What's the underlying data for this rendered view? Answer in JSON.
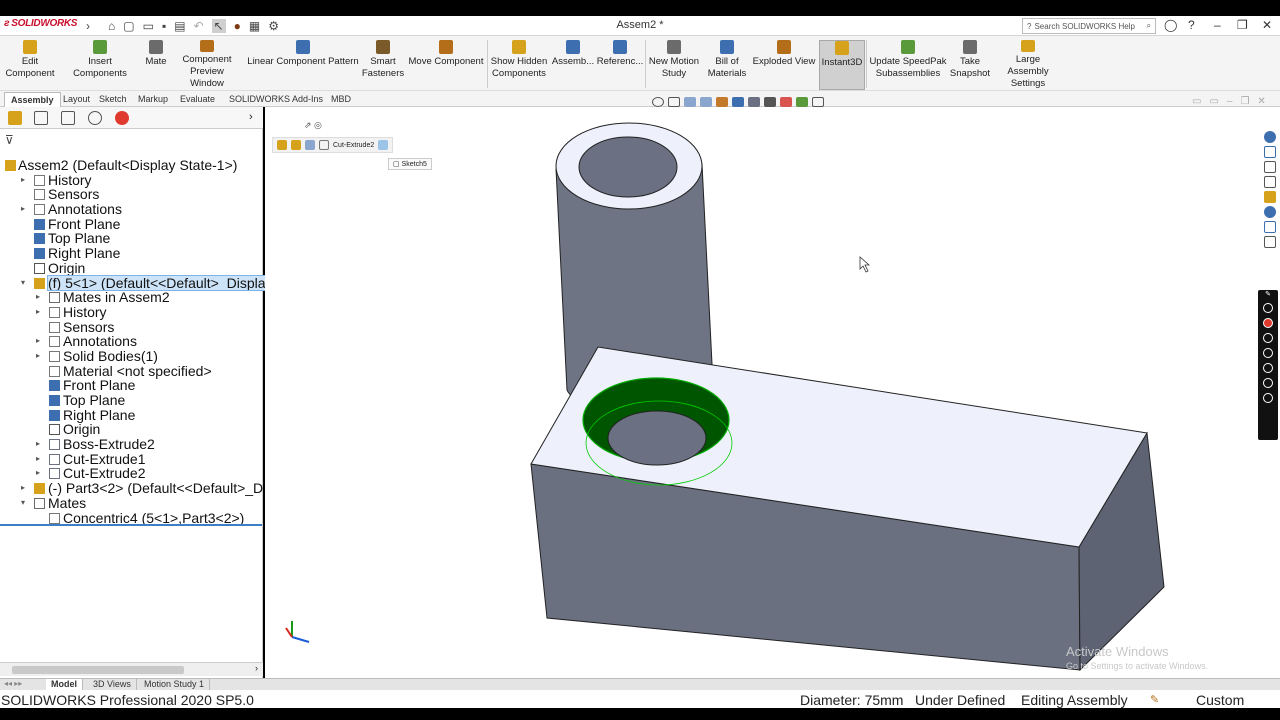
{
  "app": {
    "logo": "SOLIDWORKS",
    "window_title": "Assem2 *",
    "search_placeholder": "Search SOLIDWORKS Help"
  },
  "ribbon": {
    "buttons": [
      {
        "label": "Edit\nComponent",
        "icon": "edit-component-icon",
        "color": "#d6a21b"
      },
      {
        "label": "Insert Components",
        "icon": "insert-components-icon",
        "color": "#5a9a3a"
      },
      {
        "label": "Mate",
        "icon": "mate-icon",
        "color": "#6b6b6b"
      },
      {
        "label": "Component\nPreview Window",
        "icon": "preview-window-icon",
        "color": "#b46e1a"
      },
      {
        "label": "Linear Component Pattern",
        "icon": "linear-pattern-icon",
        "color": "#3d6fb0"
      },
      {
        "label": "Smart\nFasteners",
        "icon": "smart-fasteners-icon",
        "color": "#7b5a2a"
      },
      {
        "label": "Move Component",
        "icon": "move-component-icon",
        "color": "#b46e1a"
      },
      {
        "label": "Show Hidden\nComponents",
        "icon": "show-hidden-icon",
        "color": "#d6a21b"
      },
      {
        "label": "Assemb...",
        "icon": "assembly-features-icon",
        "color": "#3d6fb0"
      },
      {
        "label": "Referenc...",
        "icon": "reference-geometry-icon",
        "color": "#3d6fb0"
      },
      {
        "label": "New Motion\nStudy",
        "icon": "motion-study-icon",
        "color": "#6b6b6b"
      },
      {
        "label": "Bill of\nMaterials",
        "icon": "bom-icon",
        "color": "#3d6fb0"
      },
      {
        "label": "Exploded View",
        "icon": "exploded-view-icon",
        "color": "#b46e1a"
      },
      {
        "label": "Instant3D",
        "icon": "instant3d-icon",
        "color": "#d6a21b"
      },
      {
        "label": "Update SpeedPak\nSubassemblies",
        "icon": "speedpak-icon",
        "color": "#5a9a3a"
      },
      {
        "label": "Take\nSnapshot",
        "icon": "snapshot-icon",
        "color": "#6b6b6b"
      },
      {
        "label": "Large Assembly\nSettings",
        "icon": "large-assembly-icon",
        "color": "#d6a21b"
      }
    ]
  },
  "tabs": [
    "Assembly",
    "Layout",
    "Sketch",
    "Markup",
    "Evaluate",
    "SOLIDWORKS Add-Ins",
    "MBD"
  ],
  "tree": [
    {
      "label": "Assem2  (Default<Display State-1>)",
      "level": 0,
      "arrow": "",
      "icon": "assembly-icon"
    },
    {
      "label": "History",
      "level": 1,
      "arrow": "▸",
      "icon": "history-icon"
    },
    {
      "label": "Sensors",
      "level": 1,
      "arrow": "",
      "icon": "sensors-icon"
    },
    {
      "label": "Annotations",
      "level": 1,
      "arrow": "▸",
      "icon": "annotations-icon"
    },
    {
      "label": "Front Plane",
      "level": 1,
      "arrow": "",
      "icon": "plane-icon"
    },
    {
      "label": "Top Plane",
      "level": 1,
      "arrow": "",
      "icon": "plane-icon"
    },
    {
      "label": "Right Plane",
      "level": 1,
      "arrow": "",
      "icon": "plane-icon"
    },
    {
      "label": "Origin",
      "level": 1,
      "arrow": "",
      "icon": "origin-icon"
    },
    {
      "label": "(f) 5<1> (Default<<Default>_Displa",
      "level": 1,
      "arrow": "▾",
      "icon": "part-icon",
      "selected": true
    },
    {
      "label": "Mates in Assem2",
      "level": 2,
      "arrow": "▸",
      "icon": "mates-icon"
    },
    {
      "label": "History",
      "level": 2,
      "arrow": "▸",
      "icon": "history-icon"
    },
    {
      "label": "Sensors",
      "level": 2,
      "arrow": "",
      "icon": "sensors-icon"
    },
    {
      "label": "Annotations",
      "level": 2,
      "arrow": "▸",
      "icon": "annotations-icon"
    },
    {
      "label": "Solid Bodies(1)",
      "level": 2,
      "arrow": "▸",
      "icon": "solid-bodies-icon"
    },
    {
      "label": "Material <not specified>",
      "level": 2,
      "arrow": "",
      "icon": "material-icon"
    },
    {
      "label": "Front Plane",
      "level": 2,
      "arrow": "",
      "icon": "plane-icon"
    },
    {
      "label": "Top Plane",
      "level": 2,
      "arrow": "",
      "icon": "plane-icon"
    },
    {
      "label": "Right Plane",
      "level": 2,
      "arrow": "",
      "icon": "plane-icon"
    },
    {
      "label": "Origin",
      "level": 2,
      "arrow": "",
      "icon": "origin-icon"
    },
    {
      "label": "Boss-Extrude2",
      "level": 2,
      "arrow": "▸",
      "icon": "boss-extrude-icon"
    },
    {
      "label": "Cut-Extrude1",
      "level": 2,
      "arrow": "▸",
      "icon": "cut-extrude-icon"
    },
    {
      "label": "Cut-Extrude2",
      "level": 2,
      "arrow": "▸",
      "icon": "cut-extrude-icon"
    },
    {
      "label": "(-) Part3<2> (Default<<Default>_D",
      "level": 1,
      "arrow": "▸",
      "icon": "part-icon"
    },
    {
      "label": "Mates",
      "level": 1,
      "arrow": "▾",
      "icon": "mates-icon"
    },
    {
      "label": "Concentric4 (5<1>,Part3<2>)",
      "level": 2,
      "arrow": "",
      "icon": "concentric-icon"
    }
  ],
  "breadcrumb": {
    "feature": "Cut-Extrude2",
    "sketch": "Sketch5"
  },
  "bottom_tabs": [
    "Model",
    "3D Views",
    "Motion Study 1"
  ],
  "status": {
    "product": "SOLIDWORKS Professional 2020 SP5.0",
    "diameter": "Diameter: 75mm",
    "state": "Under Defined",
    "mode": "Editing Assembly",
    "units": "Custom"
  },
  "watermark": {
    "line1": "Activate Windows",
    "line2": "Go to Settings to activate Windows."
  },
  "colors": {
    "selection": "#cde3f7",
    "edge_highlight": "#00aa00",
    "body": "#6e7484",
    "top_face": "#eef0fb"
  }
}
